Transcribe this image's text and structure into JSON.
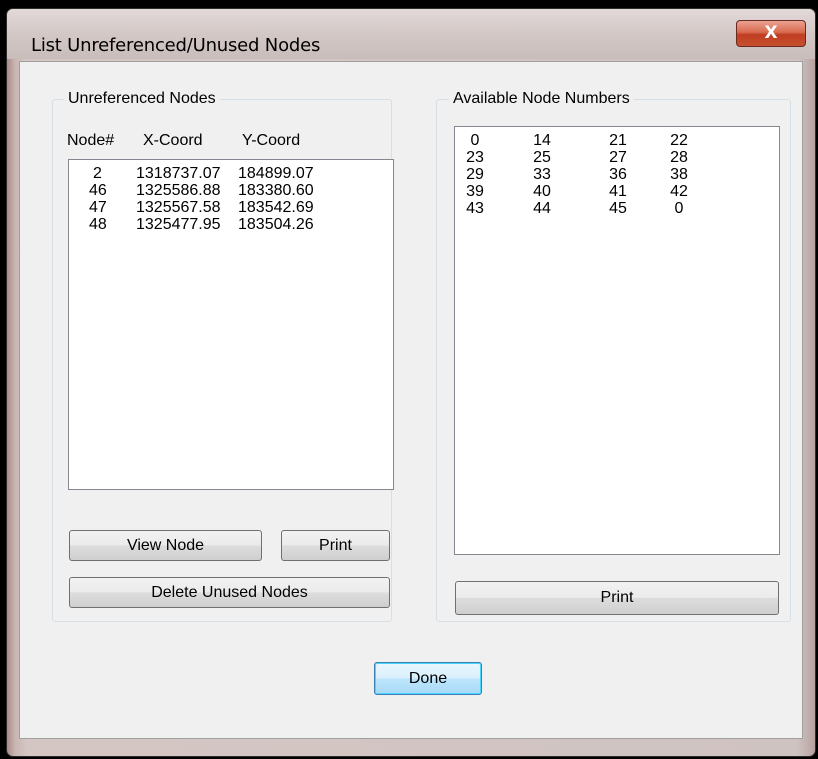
{
  "window": {
    "title": "List Unreferenced/Unused Nodes",
    "close_glyph": "X"
  },
  "unreferenced": {
    "group_label": "Unreferenced Nodes",
    "columns": [
      "Node#",
      "X-Coord",
      "Y-Coord"
    ],
    "rows": [
      {
        "node": "2",
        "x": "1318737.07",
        "y": "184899.07"
      },
      {
        "node": "46",
        "x": "1325586.88",
        "y": "183380.60"
      },
      {
        "node": "47",
        "x": "1325567.58",
        "y": "183542.69"
      },
      {
        "node": "48",
        "x": "1325477.95",
        "y": "183504.26"
      }
    ],
    "view_node_label": "View Node",
    "print_label": "Print",
    "delete_label": "Delete Unused Nodes"
  },
  "available": {
    "group_label": "Available Node Numbers",
    "grid": [
      [
        "0",
        "14",
        "21",
        "22"
      ],
      [
        "23",
        "25",
        "27",
        "28"
      ],
      [
        "29",
        "33",
        "36",
        "38"
      ],
      [
        "39",
        "40",
        "41",
        "42"
      ],
      [
        "43",
        "44",
        "45",
        "0"
      ]
    ],
    "print_label": "Print"
  },
  "done_label": "Done",
  "icons": {
    "close": "close-icon"
  }
}
